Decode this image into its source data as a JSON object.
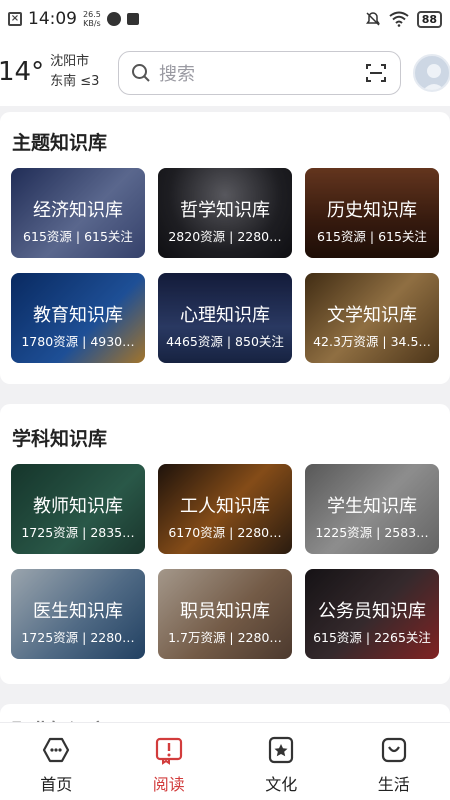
{
  "status": {
    "time": "14:09",
    "speed_value": "26.5",
    "speed_unit": "KB/s",
    "battery": "88"
  },
  "header": {
    "temperature": "14°",
    "city": "沈阳市",
    "wind": "东南 ≤3",
    "search_placeholder": "搜索"
  },
  "sections": [
    {
      "title": "主题知识库",
      "cards": [
        {
          "title": "经济知识库",
          "meta": "615资源 | 615关注",
          "color": "#5a6fa8"
        },
        {
          "title": "哲学知识库",
          "meta": "2820资源 | 2280…",
          "color": "#3b3a42"
        },
        {
          "title": "历史知识库",
          "meta": "615资源 | 615关注",
          "color": "#6b3a26"
        },
        {
          "title": "教育知识库",
          "meta": "1780资源 | 4930…",
          "color": "#1f4f9a"
        },
        {
          "title": "心理知识库",
          "meta": "4465资源 | 850关注",
          "color": "#2d3f6e"
        },
        {
          "title": "文学知识库",
          "meta": "42.3万资源 | 34.5…",
          "color": "#8a6a3c"
        }
      ]
    },
    {
      "title": "学科知识库",
      "cards": [
        {
          "title": "教师知识库",
          "meta": "1725资源 | 2835…",
          "color": "#2a5a4a"
        },
        {
          "title": "工人知识库",
          "meta": "6170资源 | 2280…",
          "color": "#7a4a22"
        },
        {
          "title": "学生知识库",
          "meta": "1225资源 | 2583…",
          "color": "#9c9c9c"
        },
        {
          "title": "医生知识库",
          "meta": "1725资源 | 2280…",
          "color": "#7f9cb8"
        },
        {
          "title": "职员知识库",
          "meta": "1.7万资源 | 2280…",
          "color": "#a88f7a"
        },
        {
          "title": "公务员知识库",
          "meta": "615资源 | 2265关注",
          "color": "#3a2a2e"
        }
      ]
    }
  ],
  "next_section_title": "职业知识库",
  "tabs": [
    {
      "label": "首页",
      "icon": "chat-bubble-icon",
      "active": false
    },
    {
      "label": "阅读",
      "icon": "book-icon",
      "active": true
    },
    {
      "label": "文化",
      "icon": "star-badge-icon",
      "active": false
    },
    {
      "label": "生活",
      "icon": "bag-smile-icon",
      "active": false
    }
  ],
  "colors": {
    "accent": "#d23c3c",
    "background": "#f1f1f3"
  }
}
